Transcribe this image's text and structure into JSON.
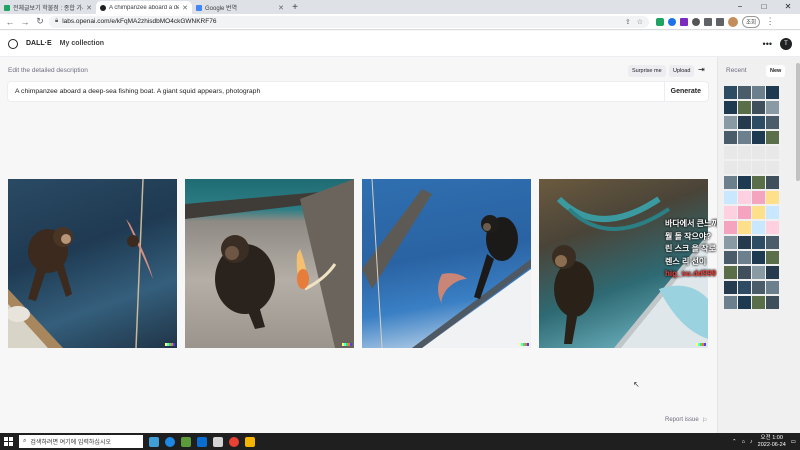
{
  "browser": {
    "tabs": [
      {
        "title": "전체글보기 학불점 : 종합 가서 ...",
        "active": false,
        "favicon_color": "#1ea362"
      },
      {
        "title": "A chimpanzee aboard a deep-s...",
        "active": true,
        "favicon_color": "#202123"
      },
      {
        "title": "Google 번역",
        "active": false,
        "favicon_color": "#4285f4"
      }
    ],
    "new_tab": "+",
    "url": "labs.openai.com/e/kFqMA2zhisdbMO4ckGWNKRF76",
    "cancel_label": "조회",
    "window_controls": [
      "−",
      "□",
      "✕"
    ]
  },
  "app": {
    "brand": "DALL·E",
    "nav_my_collection": "My collection",
    "more_icon": "•••",
    "user_initial": "T"
  },
  "editor": {
    "description_label": "Edit the detailed description",
    "surprise_label": "Surprise me",
    "upload_label": "Upload",
    "collapse_icon": "⇥",
    "prompt_text": "A chimpanzee aboard a deep-sea fishing boat. A giant squid appears, photograph",
    "generate_label": "Generate"
  },
  "images": [
    {
      "name": "result-image-1"
    },
    {
      "name": "result-image-2"
    },
    {
      "name": "result-image-3"
    },
    {
      "name": "result-image-4"
    }
  ],
  "report_label": "Report issue",
  "sidebar": {
    "recent_label": "Recent",
    "new_label": "New"
  },
  "overlay": {
    "lines": [
      "바다에서 큰느끼를 보이었다",
      "뭘 돌 작으야?",
      "린 스크 을 작로 가나",
      "렌스 리 선이",
      "hig_su.dd999"
    ],
    "line_red": "hig_su.dd999"
  },
  "taskbar": {
    "search_placeholder": "검색하려면 여기에 입력하십시오",
    "time": "오전 1:00",
    "date": "2022-06-24"
  }
}
